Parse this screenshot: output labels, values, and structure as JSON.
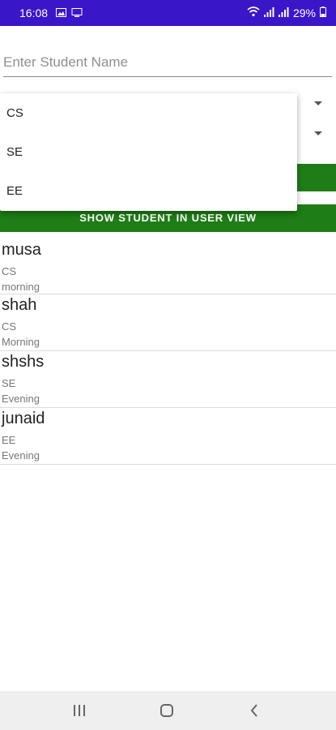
{
  "status_bar": {
    "time": "16:08",
    "battery": "29%"
  },
  "form": {
    "name_placeholder": "Enter Student Name",
    "show_button_label": "SHOW STUDENT IN USER VIEW"
  },
  "dropdown": {
    "options": [
      "CS",
      "SE",
      "EE"
    ]
  },
  "students": [
    {
      "name": "musa",
      "dept": "CS",
      "shift": "morning"
    },
    {
      "name": "shah",
      "dept": "CS",
      "shift": "Morning"
    },
    {
      "name": "shshs",
      "dept": "SE",
      "shift": "Evening"
    },
    {
      "name": "junaid",
      "dept": "EE",
      "shift": "Evening"
    }
  ],
  "icons": {
    "status": [
      "gallery-icon",
      "cast-icon",
      "wifi-icon",
      "signal-icon",
      "signal-icon",
      "battery-icon"
    ],
    "nav": [
      "recents-icon",
      "home-icon",
      "back-icon"
    ]
  },
  "colors": {
    "status_bar": "#3a16c9",
    "button_green": "#1e7d16"
  }
}
